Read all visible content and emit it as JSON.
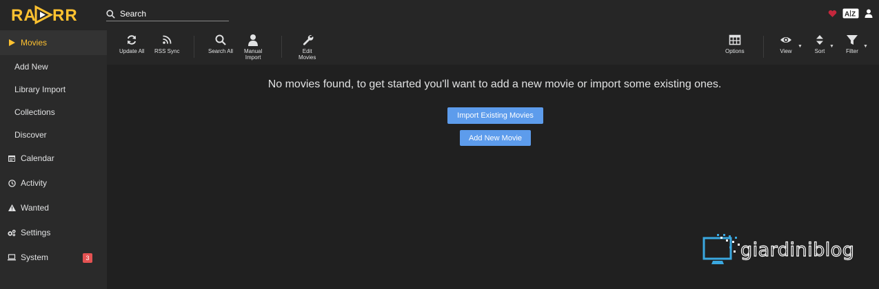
{
  "app": {
    "brand": "RADARR",
    "accent": "#ffc230",
    "button_color": "#5d9cec"
  },
  "search": {
    "placeholder": "Search"
  },
  "top_icons": [
    "heart-icon",
    "translate-icon",
    "user-icon"
  ],
  "sidebar": {
    "items": [
      {
        "label": "Movies",
        "icon": "play-icon",
        "active": true
      },
      {
        "label": "Add New",
        "sub": true
      },
      {
        "label": "Library Import",
        "sub": true
      },
      {
        "label": "Collections",
        "sub": true
      },
      {
        "label": "Discover",
        "sub": true
      },
      {
        "label": "Calendar",
        "icon": "calendar-icon"
      },
      {
        "label": "Activity",
        "icon": "clock-icon"
      },
      {
        "label": "Wanted",
        "icon": "warning-icon"
      },
      {
        "label": "Settings",
        "icon": "cogs-icon"
      },
      {
        "label": "System",
        "icon": "laptop-icon",
        "badge": "3"
      }
    ]
  },
  "toolbar": {
    "update_all": "Update All",
    "rss_sync": "RSS Sync",
    "search_all": "Search All",
    "manual_import_1": "Manual",
    "manual_import_2": "Import",
    "edit_movies_1": "Edit",
    "edit_movies_2": "Movies",
    "options": "Options",
    "view": "View",
    "sort": "Sort",
    "filter": "Filter"
  },
  "main": {
    "empty_message": "No movies found, to get started you'll want to add a new movie or import some existing ones.",
    "import_button": "Import Existing Movies",
    "add_button": "Add New Movie"
  },
  "watermark": {
    "text": "giardiniblog"
  }
}
